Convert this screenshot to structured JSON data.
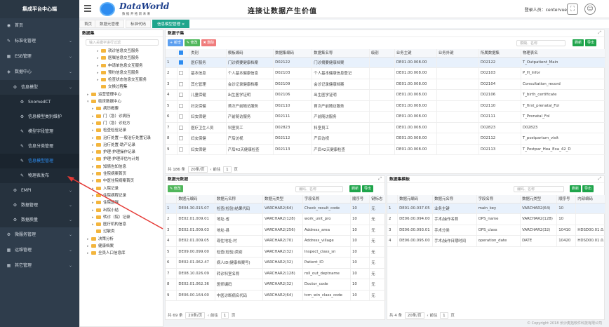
{
  "app": {
    "title": "集成平台中心端",
    "user_label": "登录人员：",
    "user_name": "centervue",
    "slogan": "连接让数据产生价值",
    "logo_text": "DataWorld",
    "logo_sub": "数 据 开 拓 新 未 来"
  },
  "sidebar": {
    "items": [
      {
        "label": "首页",
        "icon": "dashboard-icon",
        "level": 1
      },
      {
        "label": "标准化管理",
        "icon": "wrench-icon",
        "level": 1,
        "chevron": true
      },
      {
        "label": "ESB管理",
        "icon": "grid-icon",
        "level": 1,
        "chevron": true
      },
      {
        "label": "数据中心",
        "icon": "db-icon",
        "level": 1,
        "chevron": true
      },
      {
        "label": "信息模型",
        "icon": "gear-icon",
        "level": 2,
        "chevron": true
      },
      {
        "label": "SnomedCT",
        "icon": "gear-icon",
        "level": 3
      },
      {
        "label": "信息模型类别维护",
        "icon": "gear-icon",
        "level": 3
      },
      {
        "label": "模型字段管理",
        "icon": "wrench-icon",
        "level": 3
      },
      {
        "label": "信息分类管理",
        "icon": "wrench-icon",
        "level": 3
      },
      {
        "label": "信息模型管理",
        "icon": "wrench-icon",
        "level": 3,
        "active": true
      },
      {
        "label": "物理表发布",
        "icon": "wrench-icon",
        "level": 3
      },
      {
        "label": "EMPI",
        "icon": "gear-icon",
        "level": 2,
        "chevron": true
      },
      {
        "label": "数据管理",
        "icon": "gear-icon",
        "level": 2,
        "chevron": true
      },
      {
        "label": "数据质量",
        "icon": "gear-icon",
        "level": 2,
        "chevron": true
      },
      {
        "label": "微服务管理",
        "icon": "gear-icon",
        "level": 1,
        "chevron": true
      },
      {
        "label": "运维管理",
        "icon": "grid-icon",
        "level": 1,
        "chevron": true
      },
      {
        "label": "其它管理",
        "icon": "grid-icon",
        "level": 1,
        "chevron": true
      }
    ]
  },
  "tabs": [
    {
      "label": "首页"
    },
    {
      "label": "数据元管理"
    },
    {
      "label": "标准代码"
    },
    {
      "label": "信息模型管理",
      "active": true
    }
  ],
  "tree": {
    "title": "数据集",
    "search_placeholder": "输入关键字进行过滤",
    "items": [
      {
        "label": "就诊信息交互服务",
        "indent": 3,
        "arrow": "▸"
      },
      {
        "label": "医嘱信息交互服务",
        "indent": 3,
        "arrow": "▸"
      },
      {
        "label": "申请单信息交互服务",
        "indent": 3,
        "arrow": "▸"
      },
      {
        "label": "预约信息交互服务",
        "indent": 3,
        "arrow": "▸"
      },
      {
        "label": "检查状态信息交互服务",
        "indent": 3,
        "arrow": "▸"
      },
      {
        "label": "交换过程集",
        "indent": 3,
        "arrow": ""
      },
      {
        "label": "运营管理中心",
        "indent": 1,
        "arrow": "▸"
      },
      {
        "label": "临床数据中心",
        "indent": 1,
        "arrow": "▾"
      },
      {
        "label": "病历概要",
        "indent": 2,
        "arrow": "▸"
      },
      {
        "label": "门（急）诊病历",
        "indent": 2,
        "arrow": "▸"
      },
      {
        "label": "门（急）诊处方",
        "indent": 2,
        "arrow": "▸"
      },
      {
        "label": "检查检验记录",
        "indent": 2,
        "arrow": "▸"
      },
      {
        "label": "治疗处置-一般治疗处置记录",
        "indent": 2,
        "arrow": "▸"
      },
      {
        "label": "治疗处置-助产记录",
        "indent": 2,
        "arrow": "▸"
      },
      {
        "label": "护理-护理操作记录",
        "indent": 2,
        "arrow": "▸"
      },
      {
        "label": "护理-护理评估与计划",
        "indent": 2,
        "arrow": "▸"
      },
      {
        "label": "知情告知信息",
        "indent": 2,
        "arrow": "▸"
      },
      {
        "label": "住院病案首页",
        "indent": 2,
        "arrow": "▸"
      },
      {
        "label": "中医住院病案首页",
        "indent": 2,
        "arrow": "▸"
      },
      {
        "label": "入院记录",
        "indent": 2,
        "arrow": "▸"
      },
      {
        "label": "住院病程记录",
        "indent": 2,
        "arrow": "▸"
      },
      {
        "label": "住院医嘱",
        "indent": 2,
        "arrow": "▸"
      },
      {
        "label": "出院小结",
        "indent": 2,
        "arrow": "▸"
      },
      {
        "label": "转诊（院）记录",
        "indent": 2,
        "arrow": "▸"
      },
      {
        "label": "医疗机构信息",
        "indent": 2,
        "arrow": "▸"
      },
      {
        "label": "过敏类",
        "indent": 2,
        "arrow": ""
      },
      {
        "label": "决策分析",
        "indent": 1,
        "arrow": "▸"
      },
      {
        "label": "健康档案",
        "indent": 1,
        "arrow": "▸"
      },
      {
        "label": "全员人口信息库",
        "indent": 1,
        "arrow": "▸"
      }
    ]
  },
  "subset": {
    "title": "数据子集",
    "btn_add": "+ 新增",
    "btn_edit": "✎ 修改",
    "btn_delete": "✖ 删除",
    "search_placeholder": "模糊、名称",
    "btn_refresh": "刷新",
    "btn_export": "导出",
    "columns": [
      "",
      "",
      "类别",
      "模板编码",
      "数据集编码",
      "数据集名称",
      "级别",
      "业务主键",
      "业务外键",
      "所属数据集",
      "物理表名"
    ],
    "rows": [
      [
        "1",
        "on",
        "医疗服务",
        "门诊摘要健康档案",
        "D02122",
        "门诊摘要健康档案",
        "",
        "DE01.00.008.00",
        "",
        "D02122",
        "T_Outpatient_Main"
      ],
      [
        "2",
        "",
        "基本信息",
        "个人基本健康信息",
        "D02103",
        "个人基本健康信息登记",
        "",
        "DE01.00.008.00",
        "",
        "D02103",
        "P_H_Infor"
      ],
      [
        "3",
        "",
        "其它管理",
        "会诊记录健康档案",
        "D02109",
        "会诊记录健康档案",
        "",
        "DE01.00.008.00",
        "",
        "D02104",
        "Consultation_record"
      ],
      [
        "4",
        "",
        "儿童保健",
        "出生医学证明",
        "D02106",
        "出生医学证明",
        "",
        "DE01.00.008.00",
        "",
        "D02106",
        "T_birth_certificate"
      ],
      [
        "5",
        "",
        "妇女保健",
        "首次产前随访服务",
        "D02110",
        "首次产前随访服务",
        "",
        "DE01.00.008.00",
        "",
        "D02110",
        "T_first_prenatal_Fol"
      ],
      [
        "6",
        "",
        "妇女保健",
        "产前随访服务",
        "D02111",
        "产前随访服务",
        "",
        "DE01.00.008.00",
        "",
        "D02111",
        "T_Prenatal_Fol"
      ],
      [
        "7",
        "",
        "医疗卫生人员",
        "科室员工",
        "D02823",
        "科室员工",
        "",
        "DE01.00.008.00",
        "",
        "D02823",
        "D02823"
      ],
      [
        "8",
        "",
        "妇女保健",
        "产后访视",
        "D02112",
        "产后访视",
        "",
        "DE01.00.008.00",
        "",
        "D02112",
        "T_postpartum_visit"
      ],
      [
        "9",
        "",
        "妇女保健",
        "产后42天健康检查",
        "D02113",
        "产后42天健康检查",
        "",
        "DE01.00.008.00",
        "",
        "D02113",
        "T_Postpar_Hea_Exa_42_D"
      ]
    ],
    "total": "共 186 条",
    "page_size": "20条/页",
    "goto": "前往",
    "page": "1",
    "page_suffix": "页"
  },
  "elements": {
    "title": "数据元数据",
    "btn_edit": "✎ 修改",
    "search_placeholder": "编码、名称",
    "btn_refresh": "刷新",
    "btn_export": "导出",
    "columns": [
      "",
      "数据元编码",
      "数据元名称",
      "数据元类型",
      "字段名称",
      "顺序号",
      "键标志"
    ],
    "rows": [
      [
        "1",
        "DE04.30.015.07",
        "检查(检验)结果代码",
        "VARCHAR2(64)",
        "Check_result_code",
        "10",
        "无"
      ],
      [
        "2",
        "DE02.01.009.01",
        "地址-省",
        "VARCHAR2(128)",
        "work_unit_pro",
        "10",
        "无"
      ],
      [
        "3",
        "DE02.01.009.03",
        "地址-县",
        "VARCHAR2(256)",
        "Address_area",
        "10",
        "无"
      ],
      [
        "4",
        "DE02.01.009.05",
        "现住地址-村",
        "VARCHAR2(70)",
        "Address_village",
        "10",
        "无"
      ],
      [
        "5",
        "DE09.00.099.00",
        "检查(检验)类别",
        "VARCHAR2(32)",
        "Inspect_class_sn",
        "10",
        "无"
      ],
      [
        "6",
        "DE02.01.062.47",
        "病人ID(健康档案号)",
        "VARCHAR2(32)",
        "Patient_ID",
        "10",
        "无"
      ],
      [
        "7",
        "DE08.10.026.09",
        "转诊科室名称",
        "VARCHAR2(128)",
        "roll_out_deptname",
        "10",
        "无"
      ],
      [
        "8",
        "DE02.01.062.36",
        "医师编码",
        "VARCHAR2(32)",
        "Doctor_code",
        "10",
        "无"
      ],
      [
        "9",
        "DE06.00.164.00",
        "中医诊断病名代码",
        "VARCHAR2(64)",
        "tcm_win_class_code",
        "10",
        "无"
      ]
    ],
    "total": "共 69 条",
    "page_size": "20条/页",
    "goto": "前往",
    "page": "1",
    "page_suffix": "页"
  },
  "template": {
    "title": "数据集模板",
    "search_placeholder": "编码、名称",
    "btn_refresh": "刷新",
    "btn_export": "导出",
    "columns": [
      "",
      "数据元编码",
      "数据元名称",
      "字段名称",
      "数据元类型",
      "顺序号",
      "内部编码"
    ],
    "rows": [
      [
        "1",
        "DE01.00.037.05",
        "业务主键",
        "main_key",
        "VARCHAR2(64)",
        "10",
        ""
      ],
      [
        "2",
        "DE06.00.094.00",
        "手术/操作名称",
        "OPS_name",
        "VARCHAR2(128)",
        "10",
        ""
      ],
      [
        "3",
        "DE06.00.093.01",
        "手术分类",
        "OPS_class",
        "VARCHAR2(32)",
        "10410",
        "HDSD00.01.0…"
      ],
      [
        "4",
        "DE06.00.095.00",
        "手术/操作日期时间",
        "operation_date",
        "DATE",
        "10420",
        "HDSD00.01.0…"
      ]
    ],
    "total": "共 4 条",
    "page_size": "20条/页",
    "goto": "前往",
    "page": "1",
    "page_suffix": "页"
  },
  "footer": "© Copyright 2018 长沙麦拓软件科技有限公司"
}
